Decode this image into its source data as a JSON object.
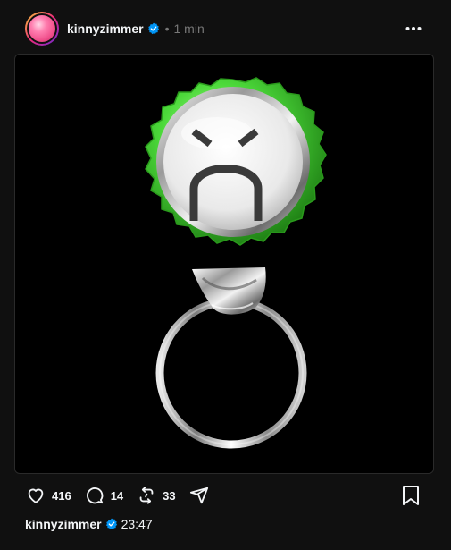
{
  "post": {
    "author": {
      "username": "kinnyzimmer",
      "verified": true,
      "avatar_icon": "pink-sphere-avatar"
    },
    "separator": "•",
    "relative_time": "1 min",
    "more_icon": "more-horizontal-icon",
    "media": {
      "description_icon": "green-bottlecap-keyring-sad-face",
      "background_color": "#000000"
    },
    "actions": {
      "likes": "416",
      "replies": "14",
      "reposts": "33"
    },
    "footer": {
      "username": "kinnyzimmer",
      "time": "23:47"
    }
  },
  "colors": {
    "background": "#101010",
    "text": "#f3f5f7",
    "muted": "#777777",
    "verified": "#0095f6",
    "cap_green": "#4cd93a"
  }
}
